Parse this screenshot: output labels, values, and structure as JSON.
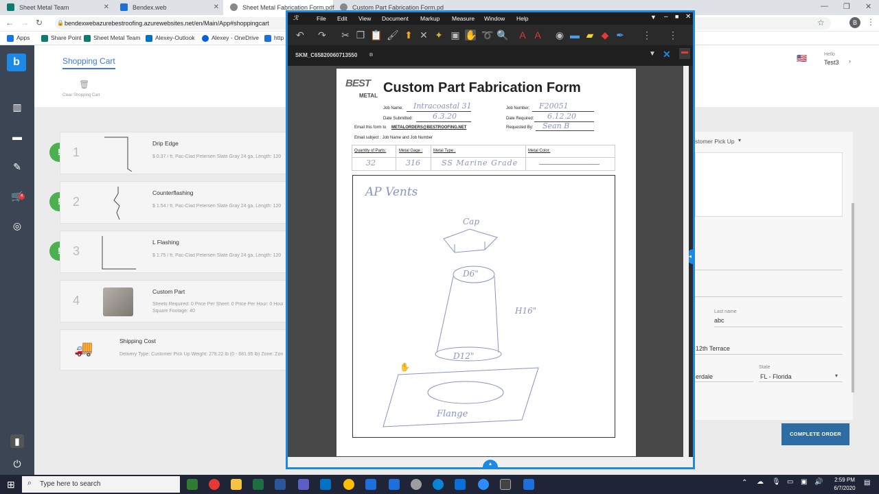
{
  "browser": {
    "tabs": [
      {
        "label": "Sheet Metal Team"
      },
      {
        "label": "Bendex.web"
      },
      {
        "label": "Sheet Metal Fabrication Form.pdf"
      },
      {
        "label": "Custom Part Fabrication Form.pd"
      }
    ],
    "url": "bendexwebazurebestroofing.azurewebsites.net/en/Main/App#shoppingcart",
    "url_partial": "p",
    "bookmarks": [
      "Apps",
      "Share Point",
      "Sheet Metal Team",
      "Alexey-Outlook",
      "Alexey - OneDrive",
      "http"
    ],
    "profile_initial": "B"
  },
  "app": {
    "page_title": "Shopping Cart",
    "clear_cart": "Clear Shopping Cart",
    "user": {
      "greeting": "Hello",
      "name": "Test3"
    },
    "items": [
      {
        "num": "1",
        "title": "Drip Edge",
        "desc": "$ 0.37 / ft, Pac-Clad Petersen Slate Gray 24 ga, Length: 120"
      },
      {
        "num": "2",
        "title": "Counterflashing",
        "desc": "$ 1.54 / ft, Pac-Clad Petersen Slate Gray 24 ga, Length: 120"
      },
      {
        "num": "3",
        "title": "L Flashing",
        "desc": "$ 1.75 / ft, Pac-Clad Petersen Slate Gray 24 ga, Length: 120"
      },
      {
        "num": "4",
        "title": "Custom Part",
        "desc": "Sheets Required: 0 Price Per Sheet: 0 Price Per Hour: 0 Hour",
        "desc2": "Square Footage: 40"
      }
    ],
    "shipping": {
      "title": "Shipping Cost",
      "desc": "Delivery Type: Customer Pick Up Weight: 278.22 lb (0 - 681.95 lb) Zone: Zon"
    },
    "delivery_select": "stomer Pick Up",
    "last_name_label": "Last name",
    "last_name_value": "abc",
    "address_value": "12th Terrace",
    "city_value": "erdale",
    "state_label": "State",
    "state_value": "FL - Florida",
    "complete_order": "COMPLETE ORDER",
    "cart_count": "4"
  },
  "pdf": {
    "menu": [
      "File",
      "Edit",
      "View",
      "Document",
      "Markup",
      "Measure",
      "Window",
      "Help"
    ],
    "tab_label": "SKM_C65820060713550",
    "form": {
      "logo_top": "BEST",
      "logo_bottom": "METAL",
      "title": "Custom Part Fabrication Form",
      "job_name_label": "Job Name:",
      "job_name_value": "Intracoastal 31",
      "date_submitted_label": "Date Submitted:",
      "date_submitted_value": "6.3.20",
      "email_label": "Email this form to",
      "email_value": "METALORDERS@BESTROOFING.NET",
      "email_subject": "Email subject : Job  Name and Job Number",
      "job_number_label": "Job Number:",
      "job_number_value": "F20051",
      "date_required_label": "Date Required:",
      "date_required_value": "6.12.20",
      "requested_by_label": "Requested By:",
      "requested_by_value": "Sean B",
      "col_qty": "Quantity of Parts:",
      "col_gage": "Metal Gage :",
      "col_type": "Metal Type :",
      "col_color": "Metal Color:",
      "qty_value": "32",
      "gage_value": "316",
      "type_value": "SS Marine Grade",
      "sketch_title": "AP Vents",
      "sketch_cap": "Cap",
      "sketch_d6": "D6\"",
      "sketch_h16": "H16\"",
      "sketch_d12": "D12\"",
      "sketch_flange": "Flange"
    }
  },
  "taskbar": {
    "search_placeholder": "Type here to search",
    "time": "2:59 PM",
    "date": "6/7/2020"
  },
  "colors": {
    "accent": "#1e88e5",
    "complete_btn": "#2e6da4",
    "warning": "#4caf50"
  }
}
